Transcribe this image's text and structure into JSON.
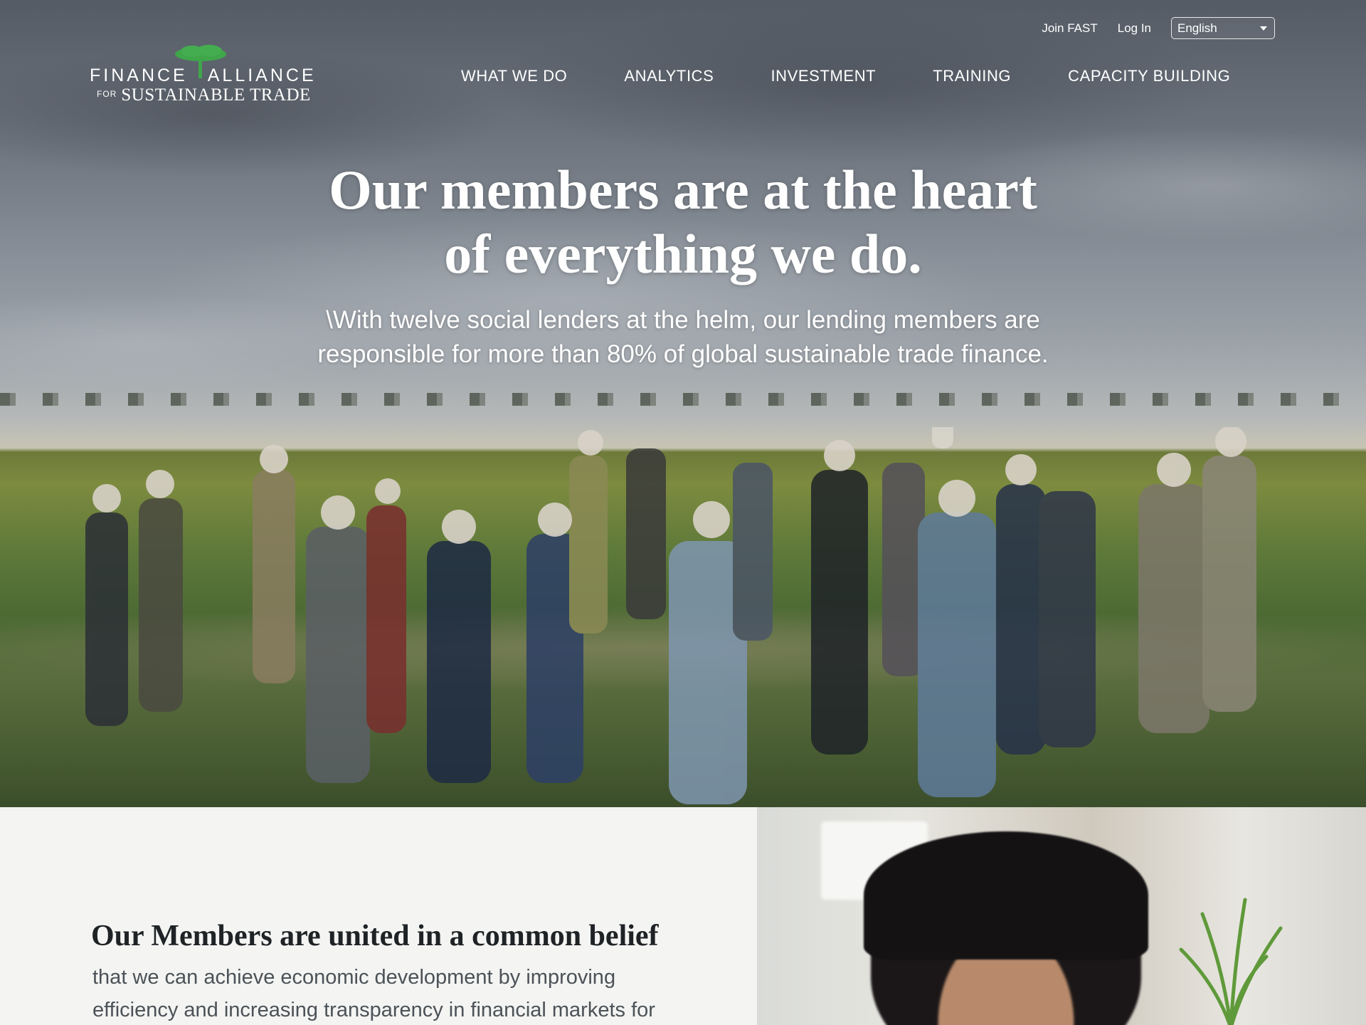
{
  "header": {
    "logo": {
      "line1_left": "FINANCE",
      "line1_right": "ALLIANCE",
      "line2_prefix": "FOR",
      "line2_main": "SUSTAINABLE TRADE",
      "tree_color": "#3fa64a"
    },
    "utility": {
      "join_label": "Join FAST",
      "login_label": "Log In",
      "language_selected": "English"
    },
    "nav": [
      {
        "label": "WHAT WE DO"
      },
      {
        "label": "ANALYTICS"
      },
      {
        "label": "INVESTMENT"
      },
      {
        "label": "TRAINING"
      },
      {
        "label": "CAPACITY BUILDING"
      }
    ]
  },
  "hero": {
    "title_line1": "Our members are at the heart",
    "title_line2": "of everything we do.",
    "subtitle_line1": "\\With twelve social lenders at the helm, our lending members are",
    "subtitle_line2": "responsible for more than 80% of global sustainable trade finance."
  },
  "section": {
    "title": "Our Members are united in a common belief",
    "body_line1": "that we can achieve economic development by improving",
    "body_line2": "efficiency and increasing transparency in financial markets for"
  }
}
